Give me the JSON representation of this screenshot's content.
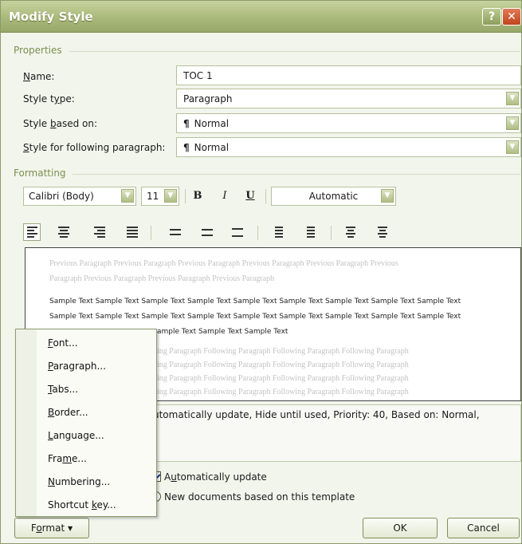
{
  "window": {
    "title": "Modify Style",
    "help_label": "?",
    "close_label": "✕"
  },
  "sections": {
    "properties": "Properties",
    "formatting": "Formatting"
  },
  "properties": {
    "name_label": "Name:",
    "name_value": "TOC 1",
    "style_type_label": "Style type:",
    "style_type_value": "Paragraph",
    "based_on_label": "Style based on:",
    "based_on_value": "Normal",
    "following_label": "Style for following paragraph:",
    "following_value": "Normal"
  },
  "formatting": {
    "font": "Calibri (Body)",
    "size": "11",
    "bold": "B",
    "italic": "I",
    "underline": "U",
    "color": "Automatic"
  },
  "preview": {
    "previous_lines": [
      "Previous Paragraph Previous Paragraph Previous Paragraph Previous Paragraph Previous Paragraph Previous",
      "Paragraph Previous Paragraph Previous Paragraph Previous Paragraph"
    ],
    "sample_lines": [
      "Sample Text Sample Text Sample Text Sample Text Sample Text Sample Text Sample Text Sample Text Sample Text",
      "Sample Text Sample Text Sample Text Sample Text Sample Text Sample Text Sample Text Sample Text Sample Text",
      "ample Text Sample Text Sample Text"
    ],
    "following_lines": [
      "ing Paragraph Following Paragraph Following Paragraph Following Paragraph",
      "ing Paragraph Following Paragraph Following Paragraph Following Paragraph",
      "ing Paragraph Following Paragraph Following Paragraph Following Paragraph",
      "ing Paragraph Following Paragraph Following Paragraph Following Paragraph",
      "ing Paragraph Following Paragraph Following Paragraph Following Paragraph"
    ]
  },
  "description": "utomatically update, Hide until used, Priority: 40, Based on: Normal,",
  "options": {
    "auto_update": "Automatically update",
    "new_docs": "New documents based on this template"
  },
  "buttons": {
    "format": "Format",
    "ok": "OK",
    "cancel": "Cancel"
  },
  "menu": {
    "items": [
      {
        "pre": "",
        "key": "F",
        "post": "ont..."
      },
      {
        "pre": "",
        "key": "P",
        "post": "aragraph..."
      },
      {
        "pre": "",
        "key": "T",
        "post": "abs..."
      },
      {
        "pre": "",
        "key": "B",
        "post": "order..."
      },
      {
        "pre": "",
        "key": "L",
        "post": "anguage..."
      },
      {
        "pre": "Fra",
        "key": "m",
        "post": "e..."
      },
      {
        "pre": "",
        "key": "N",
        "post": "umbering..."
      },
      {
        "pre": "Shortcut ",
        "key": "k",
        "post": "ey..."
      }
    ]
  },
  "icons": [
    "align-left-icon",
    "align-center-icon",
    "align-right-icon",
    "justify-icon",
    "single-spacing-icon",
    "one-half-spacing-icon",
    "double-spacing-icon",
    "increase-paragraph-spacing-icon",
    "decrease-paragraph-spacing-icon",
    "decrease-indent-icon",
    "increase-indent-icon"
  ],
  "colors": {
    "title_bar": "#a9b97a",
    "dialog_bg": "#f2f5ec",
    "section_label": "#7a8f4f",
    "preview_gray": "#c3c3c3"
  }
}
